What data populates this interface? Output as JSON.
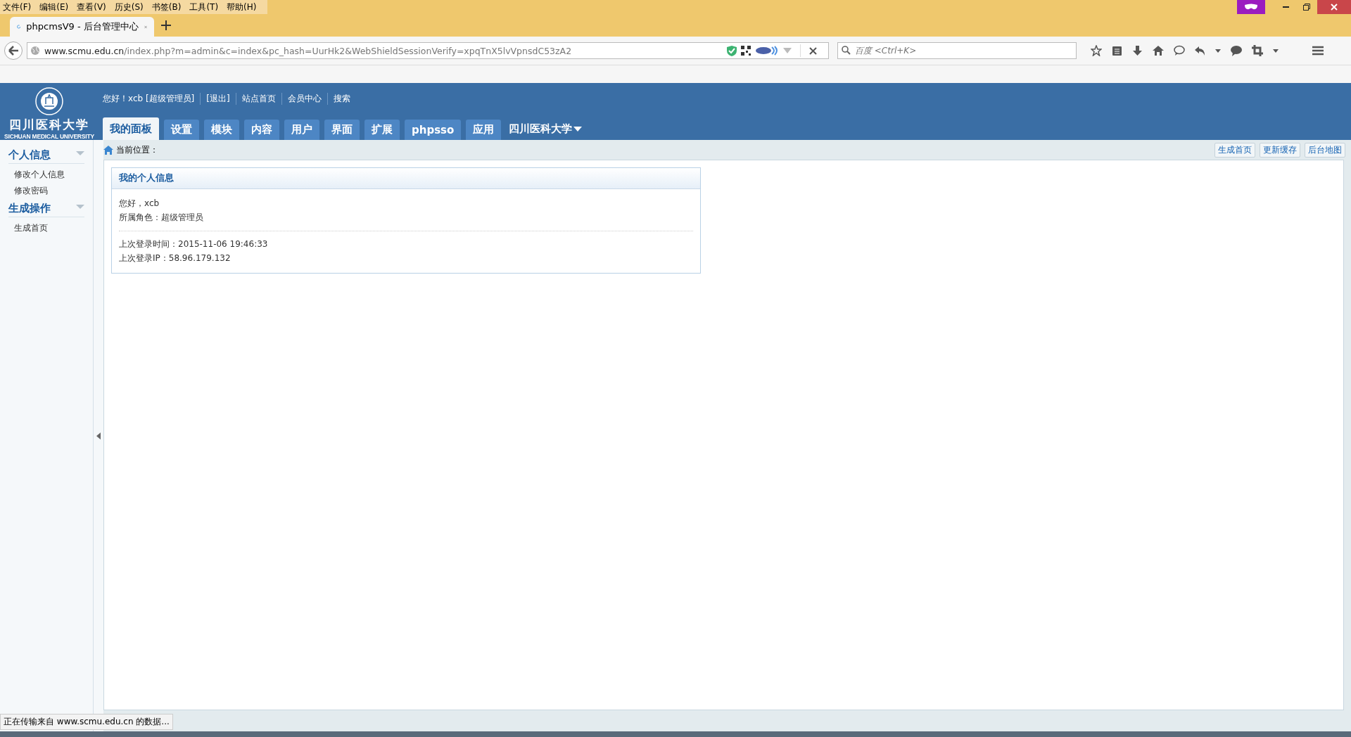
{
  "browser": {
    "menu": [
      "文件(F)",
      "编辑(E)",
      "查看(V)",
      "历史(S)",
      "书签(B)",
      "工具(T)",
      "帮助(H)"
    ],
    "tab": {
      "title": "phpcmsV9 - 后台管理中心"
    },
    "address": {
      "host": "www.scmu.edu.cn",
      "path": "/index.php?m=admin&c=index&pc_hash=UurHk2&WebShieldSessionVerify=xpqTnX5lvVpnsdC53zA2"
    },
    "search": {
      "placeholder": "百度 <Ctrl+K>"
    },
    "status": "正在传输来自 www.scmu.edu.cn 的数据..."
  },
  "header": {
    "logo": {
      "name": "四川医科大学",
      "subtitle": "SICHUAN MEDICAL UNIVERSITY"
    },
    "greeting": "您好！xcb [超级管理员]",
    "links": [
      "[退出]",
      "站点首页",
      "会员中心",
      "搜索"
    ],
    "nav": [
      {
        "label": "我的面板",
        "selected": true
      },
      {
        "label": "设置",
        "selected": false
      },
      {
        "label": "模块",
        "selected": false
      },
      {
        "label": "内容",
        "selected": false
      },
      {
        "label": "用户",
        "selected": false
      },
      {
        "label": "界面",
        "selected": false
      },
      {
        "label": "扩展",
        "selected": false
      },
      {
        "label": "phpsso",
        "selected": false
      },
      {
        "label": "应用",
        "selected": false
      }
    ],
    "site_menu": "四川医科大学"
  },
  "sidebar": {
    "sections": [
      {
        "title": "个人信息",
        "expanded": true,
        "items": [
          "修改个人信息",
          "修改密码"
        ]
      },
      {
        "title": "生成操作",
        "expanded": true,
        "items": [
          "生成首页"
        ]
      }
    ]
  },
  "main": {
    "breadcrumb": "当前位置：",
    "actions": [
      "生成首页",
      "更新缓存",
      "后台地图"
    ],
    "card": {
      "title": "我的个人信息",
      "groups": [
        [
          "您好，xcb",
          "所属角色：超级管理员"
        ],
        [
          "上次登录时间：2015-11-06 19:46:33",
          "上次登录IP：58.96.179.132"
        ]
      ]
    }
  }
}
